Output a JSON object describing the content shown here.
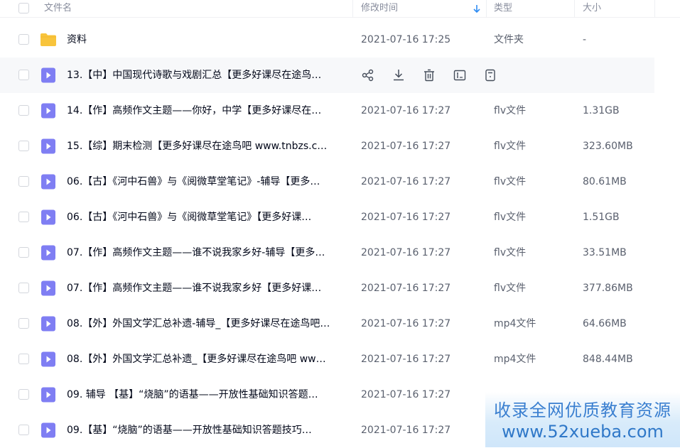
{
  "header": {
    "name_label": "文件名",
    "modified_label": "修改时间",
    "type_label": "类型",
    "size_label": "大小",
    "sort_icon": "arrow-down-icon"
  },
  "rows": [
    {
      "kind": "folder",
      "name": "资料",
      "date": "2021-07-16 17:25",
      "type": "文件夹",
      "size": "-"
    },
    {
      "kind": "video",
      "name": "13.【中】中国现代诗歌与戏剧汇总【更多好课尽在途鸟…",
      "date": "",
      "type": "",
      "size": "",
      "hover": true
    },
    {
      "kind": "video",
      "name": "14.【作】高频作文主题——你好，中学【更多好课尽在…",
      "date": "2021-07-16 17:27",
      "type": "flv文件",
      "size": "1.31GB"
    },
    {
      "kind": "video",
      "name": "15.【综】期末检测【更多好课尽在途鸟吧 www.tnbzs.c…",
      "date": "2021-07-16 17:27",
      "type": "flv文件",
      "size": "323.60MB"
    },
    {
      "kind": "video",
      "name": "06.【古】《河中石兽》与《阅微草堂笔记》-辅导【更多…",
      "date": "2021-07-16 17:27",
      "type": "flv文件",
      "size": "80.61MB"
    },
    {
      "kind": "video",
      "name": "06.【古】《河中石兽》与《阅微草堂笔记》【更多好课…",
      "date": "2021-07-16 17:27",
      "type": "flv文件",
      "size": "1.51GB"
    },
    {
      "kind": "video",
      "name": "07.【作】高频作文主题——谁不说我家乡好-辅导【更多…",
      "date": "2021-07-16 17:27",
      "type": "flv文件",
      "size": "33.51MB"
    },
    {
      "kind": "video",
      "name": "07.【作】高频作文主题——谁不说我家乡好【更多好课…",
      "date": "2021-07-16 17:27",
      "type": "flv文件",
      "size": "377.86MB"
    },
    {
      "kind": "video",
      "name": "08.【外】外国文学汇总补遗-辅导_【更多好课尽在途鸟吧…",
      "date": "2021-07-16 17:27",
      "type": "mp4文件",
      "size": "64.66MB"
    },
    {
      "kind": "video",
      "name": "08.【外】外国文学汇总补遗_【更多好课尽在途鸟吧 ww…",
      "date": "2021-07-16 17:27",
      "type": "mp4文件",
      "size": "848.44MB"
    },
    {
      "kind": "video",
      "name": "09. 辅导 【基】“烧脑”的语基——开放性基础知识答题…",
      "date": "2021-07-16 17:27",
      "type": "",
      "size": ""
    },
    {
      "kind": "video",
      "name": "09.【基】“烧脑”的语基——开放性基础知识答题技巧…",
      "date": "2021-07-16 17:27",
      "type": "",
      "size": ""
    }
  ],
  "row_actions": [
    "share-icon",
    "download-icon",
    "delete-icon",
    "rename-icon",
    "more-icon"
  ],
  "watermark": {
    "line1": "收录全网优质教育资源",
    "line2": "www.52xueba.com"
  },
  "colors": {
    "folder": "#f8c43c",
    "video": "#7f7ef3",
    "sort_arrow": "#2f8cf3",
    "watermark_text": "#3a7fd0"
  }
}
